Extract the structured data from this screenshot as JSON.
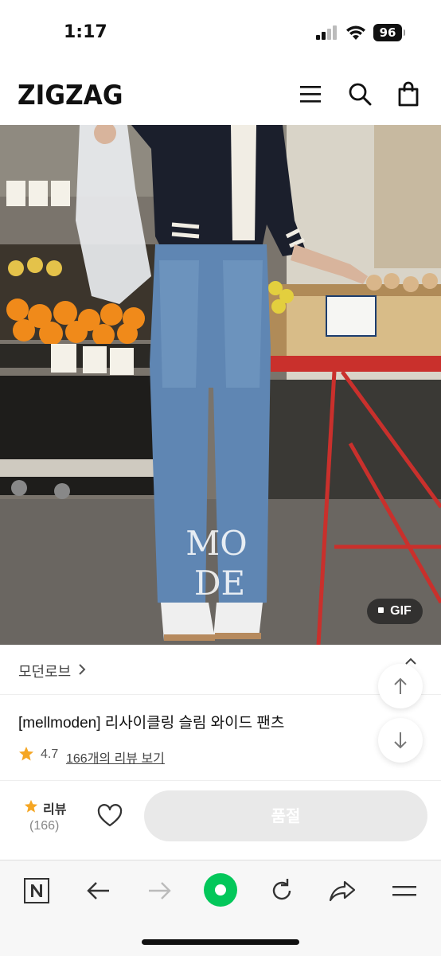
{
  "status_bar": {
    "time": "1:17",
    "battery": "96"
  },
  "header": {
    "logo": "ZIGZAG",
    "icons": [
      "menu-icon",
      "search-icon",
      "shopping-bag-icon"
    ]
  },
  "product": {
    "image_badge": "GIF",
    "watermark": "MODE",
    "brand": "모던로브",
    "title": "[mellmoden] 리사이클링 슬림 와이드 팬츠",
    "rating": "4.7",
    "review_link": "166개의 리뷰 보기"
  },
  "bottom_actions": {
    "review_label": "리뷰",
    "review_count": "(166)",
    "soldout_label": "품절"
  },
  "browser_toolbar": {
    "icons": [
      "naver-icon",
      "back-arrow-icon",
      "forward-arrow-icon",
      "green-home-dot-icon",
      "reload-icon",
      "share-icon",
      "menu-icon"
    ]
  },
  "colors": {
    "accent_star": "#f5a623",
    "green": "#03c75a",
    "soldout_bg": "#e9e9e9"
  }
}
